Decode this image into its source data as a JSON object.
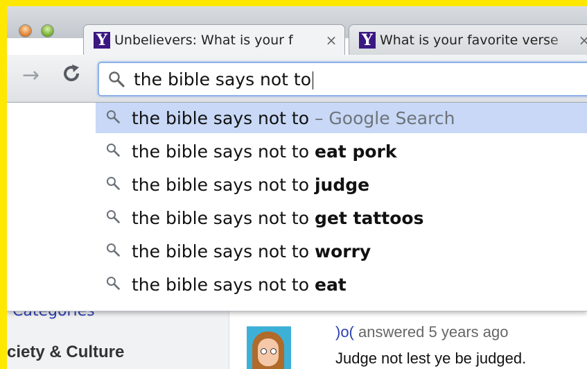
{
  "tabs": [
    {
      "favicon": "Y",
      "title": "Unbelievers: What is your f",
      "close": "×"
    },
    {
      "favicon": "Y",
      "title": "What is your favorite verse",
      "close": "×"
    }
  ],
  "toolbar": {
    "forward_icon": "→",
    "reload_icon": "C",
    "omnibox_value": "the bible says not to"
  },
  "suggestions": [
    {
      "prefix": "the bible says not to",
      "completion": "",
      "suffix": " – Google Search"
    },
    {
      "prefix": "the bible says not to ",
      "completion": "eat pork",
      "suffix": ""
    },
    {
      "prefix": "the bible says not to ",
      "completion": "judge",
      "suffix": ""
    },
    {
      "prefix": "the bible says not to ",
      "completion": "get tattoos",
      "suffix": ""
    },
    {
      "prefix": "the bible says not to ",
      "completion": "worry",
      "suffix": ""
    },
    {
      "prefix": "the bible says not to ",
      "completion": "eat",
      "suffix": ""
    }
  ],
  "page": {
    "categories": "Categories",
    "society": "ciety & Culture",
    "answer_user": ")o(",
    "answer_meta": " answered 5 years ago",
    "answer_text": "Judge not lest ye be judged."
  },
  "colors": {
    "highlight": "#c8d8f6",
    "border_yellow": "#ffe800",
    "link": "#2d3fb0"
  }
}
